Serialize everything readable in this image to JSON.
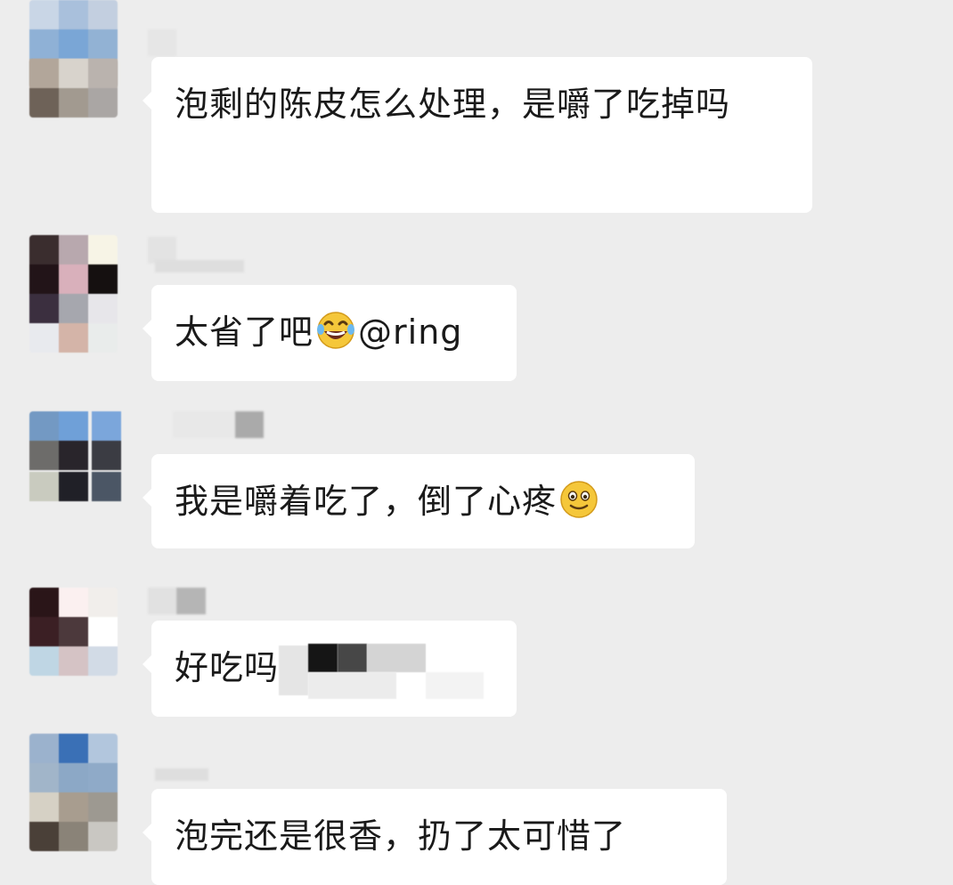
{
  "messages": [
    {
      "text": "泡剩的陈皮怎么处理，是嚼了吃掉吗"
    },
    {
      "text": "太省了吧",
      "emoji": "laugh-cry-emoji",
      "mention": "@ring"
    },
    {
      "text": "我是嚼着吃了，倒了心疼",
      "emoji": "smile-emoji"
    },
    {
      "text": "好吃吗"
    },
    {
      "text": "泡完还是很香，扔了太可惜了"
    }
  ],
  "colors": {
    "background": "#ededed",
    "bubble": "#ffffff",
    "text": "#1a1a1a"
  }
}
